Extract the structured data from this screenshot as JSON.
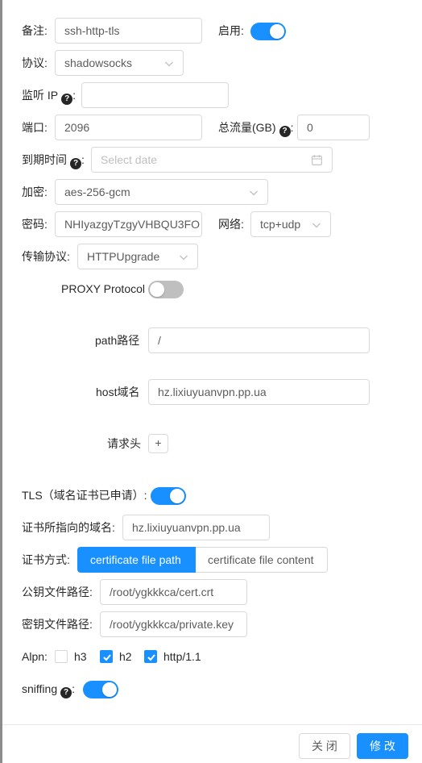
{
  "remark": {
    "label": "备注:",
    "value": "ssh-http-tls"
  },
  "enable": {
    "label": "启用:",
    "on": true
  },
  "protocol": {
    "label": "协议:",
    "value": "shadowsocks"
  },
  "listen_ip": {
    "label": "监听 IP",
    "colon": ":",
    "value": ""
  },
  "port": {
    "label": "端口:",
    "value": "2096"
  },
  "total_traffic": {
    "label": "总流量(GB)",
    "colon": ":",
    "value": "0"
  },
  "expiry": {
    "label": "到期时间",
    "colon": ":",
    "placeholder": "Select date"
  },
  "encryption": {
    "label": "加密:",
    "value": "aes-256-gcm"
  },
  "password": {
    "label": "密码:",
    "value": "NHIyazgyTzgyVHBQU3FO"
  },
  "network": {
    "label": "网络:",
    "value": "tcp+udp"
  },
  "transport": {
    "label": "传输协议:",
    "value": "HTTPUpgrade"
  },
  "proxy_protocol": {
    "label": "PROXY Protocol",
    "on": false
  },
  "path": {
    "label": "path路径",
    "value": "/"
  },
  "host": {
    "label": "host域名",
    "value": "hz.lixiuyuanvpn.pp.ua"
  },
  "headers": {
    "label": "请求头",
    "add": "+"
  },
  "tls": {
    "label": "TLS（域名证书已申请）:",
    "on": true
  },
  "cert_domain": {
    "label": "证书所指向的域名:",
    "value": "hz.lixiuyuanvpn.pp.ua"
  },
  "cert_mode": {
    "label": "证书方式:",
    "options": [
      "certificate file path",
      "certificate file content"
    ],
    "selected": 0
  },
  "public_key": {
    "label": "公钥文件路径:",
    "value": "/root/ygkkkca/cert.crt"
  },
  "private_key": {
    "label": "密钥文件路径:",
    "value": "/root/ygkkkca/private.key"
  },
  "alpn": {
    "label": "Alpn:",
    "options": [
      {
        "label": "h3",
        "checked": false
      },
      {
        "label": "h2",
        "checked": true
      },
      {
        "label": "http/1.1",
        "checked": true
      }
    ]
  },
  "sniffing": {
    "label": "sniffing",
    "colon": ":",
    "on": true
  },
  "footer": {
    "close": "关 闭",
    "modify": "修 改"
  },
  "colors": {
    "primary": "#1890ff",
    "switch_off": "#bfbfbf",
    "border": "#d9d9d9"
  }
}
